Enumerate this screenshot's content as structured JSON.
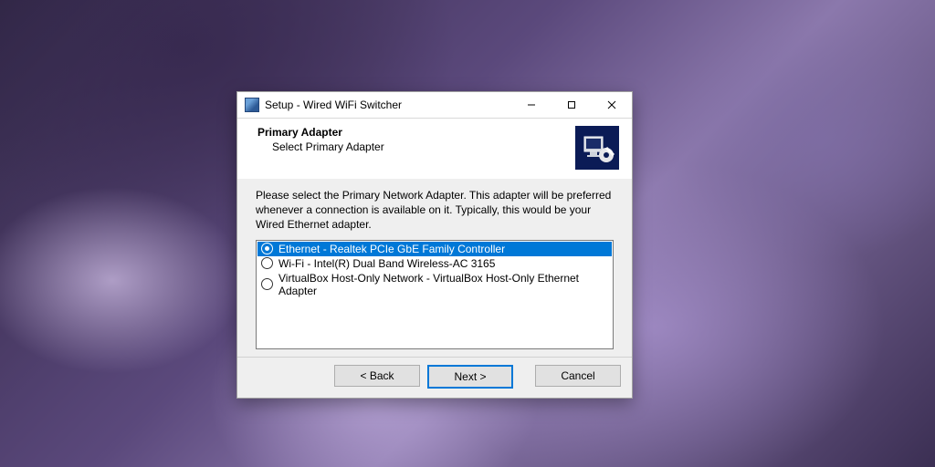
{
  "window": {
    "title": "Setup - Wired WiFi Switcher"
  },
  "header": {
    "title": "Primary Adapter",
    "subtitle": "Select Primary Adapter"
  },
  "body": {
    "instructions": "Please select the Primary Network Adapter. This adapter will be preferred whenever a connection is available on it. Typically, this would be your Wired Ethernet adapter.",
    "options": [
      {
        "label": "Ethernet - Realtek PCIe GbE Family Controller",
        "selected": true
      },
      {
        "label": "Wi-Fi - Intel(R) Dual Band Wireless-AC 3165",
        "selected": false
      },
      {
        "label": "VirtualBox Host-Only Network - VirtualBox Host-Only Ethernet Adapter",
        "selected": false
      }
    ]
  },
  "footer": {
    "back": "< Back",
    "next": "Next >",
    "cancel": "Cancel"
  }
}
